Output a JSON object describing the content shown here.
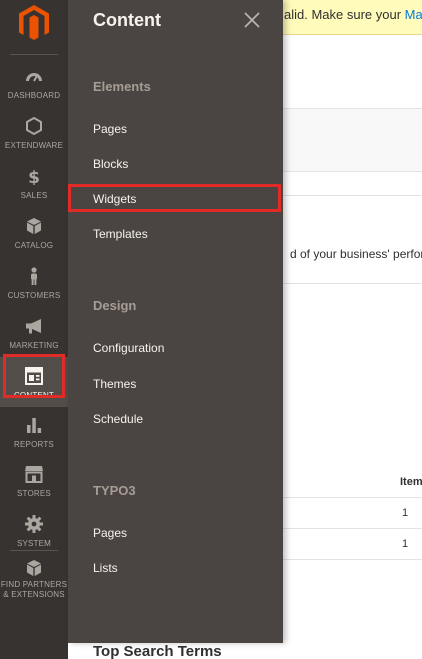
{
  "notice": {
    "text_prefix": "alid. Make sure your ",
    "link": "Magen"
  },
  "background": {
    "text": "d of your business' perfor",
    "column_header": "Item",
    "cells": [
      "1",
      "1"
    ],
    "heading": "Top Search Terms"
  },
  "nav": {
    "items": [
      {
        "id": "dashboard",
        "label": "DASHBOARD",
        "icon": "dashboard-icon"
      },
      {
        "id": "extendware",
        "label": "EXTENDWARE",
        "icon": "hexagon-icon"
      },
      {
        "id": "sales",
        "label": "SALES",
        "icon": "dollar-icon"
      },
      {
        "id": "catalog",
        "label": "CATALOG",
        "icon": "box-icon"
      },
      {
        "id": "customers",
        "label": "CUSTOMERS",
        "icon": "person-icon"
      },
      {
        "id": "marketing",
        "label": "MARKETING",
        "icon": "megaphone-icon"
      },
      {
        "id": "content",
        "label": "CONTENT",
        "icon": "layout-icon",
        "active": true
      },
      {
        "id": "reports",
        "label": "REPORTS",
        "icon": "bar-chart-icon"
      },
      {
        "id": "stores",
        "label": "STORES",
        "icon": "store-icon"
      },
      {
        "id": "system",
        "label": "SYSTEM",
        "icon": "gear-icon"
      },
      {
        "id": "partners",
        "label": "FIND PARTNERS & EXTENSIONS",
        "label_line1": "FIND PARTNERS",
        "label_line2": "& EXTENSIONS",
        "icon": "package-icon"
      }
    ]
  },
  "panel": {
    "title": "Content",
    "sections": [
      {
        "title": "Elements",
        "links": [
          "Pages",
          "Blocks",
          "Widgets",
          "Templates"
        ]
      },
      {
        "title": "Design",
        "links": [
          "Configuration",
          "Themes",
          "Schedule"
        ]
      },
      {
        "title": "TYPO3",
        "links": [
          "Pages",
          "Lists"
        ]
      }
    ]
  },
  "colors": {
    "nav_bg": "#373330",
    "panel_bg": "#4a4542",
    "highlight": "#e02b27",
    "brand": "#eb5202"
  }
}
